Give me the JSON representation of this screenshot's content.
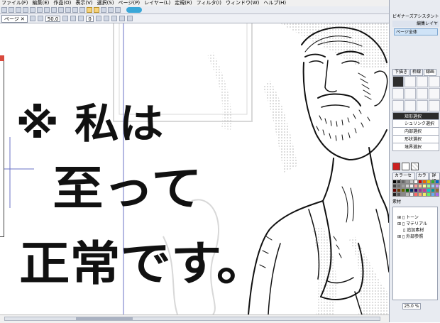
{
  "menu": [
    "ファイル(F)",
    "編集(E)",
    "作品(O)",
    "表示(V)",
    "選択(S)",
    "ページ(P)",
    "レイヤー(L)",
    "定規(R)",
    "フィルタ(I)",
    "ウィンドウ(W)",
    "ヘルプ(H)"
  ],
  "toolbar2": {
    "page_tab": "ページ",
    "zoom_value": "50.0",
    "rotate_value": "0"
  },
  "canvas_text": {
    "line1": "※ 私は",
    "line2": "至って",
    "line3": "正常です。"
  },
  "side": {
    "title": "ビギナーズアシスタント",
    "header": "編集レイヤ",
    "page_item": "ページ全体",
    "tabs": [
      "下描き",
      "枠線",
      "線画"
    ],
    "options": [
      "矩形選択",
      "シュリンク選択",
      "内部選択",
      "形状選択",
      "境界選択"
    ],
    "color_tabs": [
      "カラーセット",
      "カラー",
      "詳細"
    ],
    "material_title": "素材",
    "tree": [
      "トーン",
      "マテリアル",
      "追加素材",
      "外部参照"
    ],
    "zoom": "25.0 %"
  },
  "colors": {
    "selection_bg": "#2b2b2b",
    "accent_red": "#cc1f1f",
    "toolbar_pill": "#3aa7d8"
  }
}
